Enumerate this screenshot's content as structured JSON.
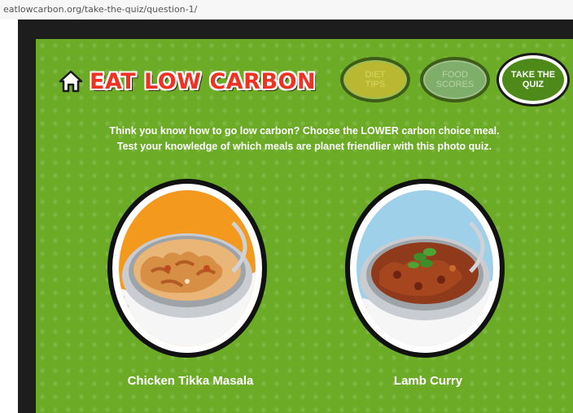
{
  "browser": {
    "url": "eatlowcarbon.org/take-the-quiz/question-1/"
  },
  "header": {
    "logo_title": "EAT LOW CARBON",
    "home_icon": "home-icon",
    "nav": [
      {
        "label": "DIET\nTIPS"
      },
      {
        "label": "FOOD\nSCORES"
      },
      {
        "label": "TAKE THE\nQUIZ"
      }
    ]
  },
  "intro": {
    "line1": "Think you know how to go low carbon? Choose the LOWER carbon choice meal.",
    "line2": "Test your knowledge of which meals are planet friendlier with this photo quiz."
  },
  "choices": [
    {
      "label": "Chicken Tikka Masala",
      "bg_color": "#f39a1e"
    },
    {
      "label": "Lamb Curry",
      "bg_color": "#9fd0ea"
    }
  ],
  "colors": {
    "site_green": "#6bab25",
    "logo_red": "#ee3224"
  }
}
